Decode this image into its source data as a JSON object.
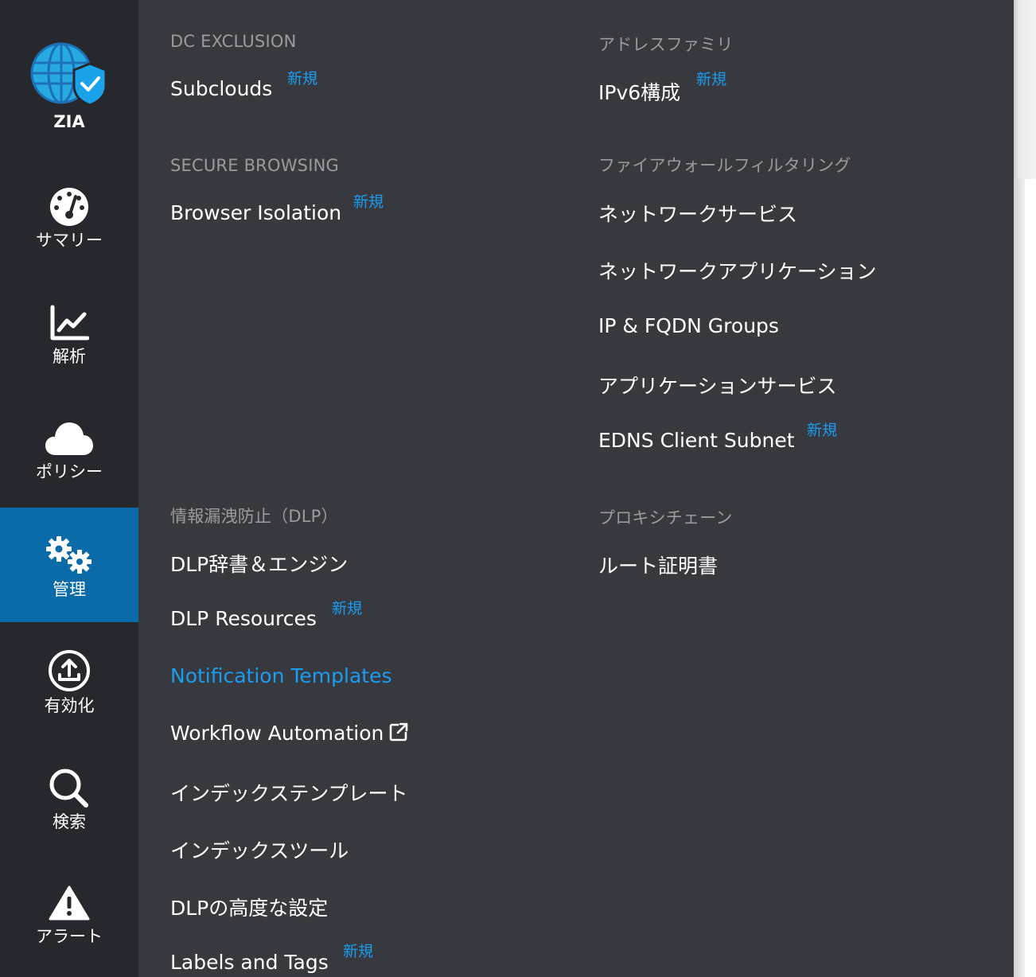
{
  "nav": {
    "zia": "ZIA",
    "summary": "サマリー",
    "analysis": "解析",
    "policy": "ポリシー",
    "admin": "管理",
    "activate": "有効化",
    "search": "検索",
    "alerts": "アラート"
  },
  "badge_new": "新規",
  "col1": {
    "dc_exclusion": {
      "header": "DC EXCLUSION",
      "subclouds": "Subclouds"
    },
    "secure_browsing": {
      "header": "SECURE BROWSING",
      "browser_isolation": "Browser Isolation"
    },
    "dlp": {
      "header": "情報漏洩防止（DLP）",
      "dictionaries": "DLP辞書＆エンジン",
      "resources": "DLP Resources",
      "notification_templates": "Notification Templates",
      "workflow_automation": "Workflow Automation",
      "index_templates": "インデックステンプレート",
      "index_tools": "インデックスツール",
      "advanced_settings": "DLPの高度な設定",
      "labels_tags": "Labels and Tags"
    }
  },
  "col2": {
    "address_family": {
      "header": "アドレスファミリ",
      "ipv6": "IPv6構成"
    },
    "firewall": {
      "header": "ファイアウォールフィルタリング",
      "network_services": "ネットワークサービス",
      "network_applications": "ネットワークアプリケーション",
      "ip_fqdn_groups": "IP & FQDN Groups",
      "application_services": "アプリケーションサービス",
      "edns_client_subnet": "EDNS Client Subnet"
    },
    "proxy_chain": {
      "header": "プロキシチェーン",
      "root_certificate": "ルート証明書"
    }
  },
  "colors": {
    "nav_bg": "#26282d",
    "nav_active": "#0b6aa8",
    "panel_bg": "#38393e",
    "accent": "#1a9cf0",
    "section_header": "#9a9ba0"
  }
}
